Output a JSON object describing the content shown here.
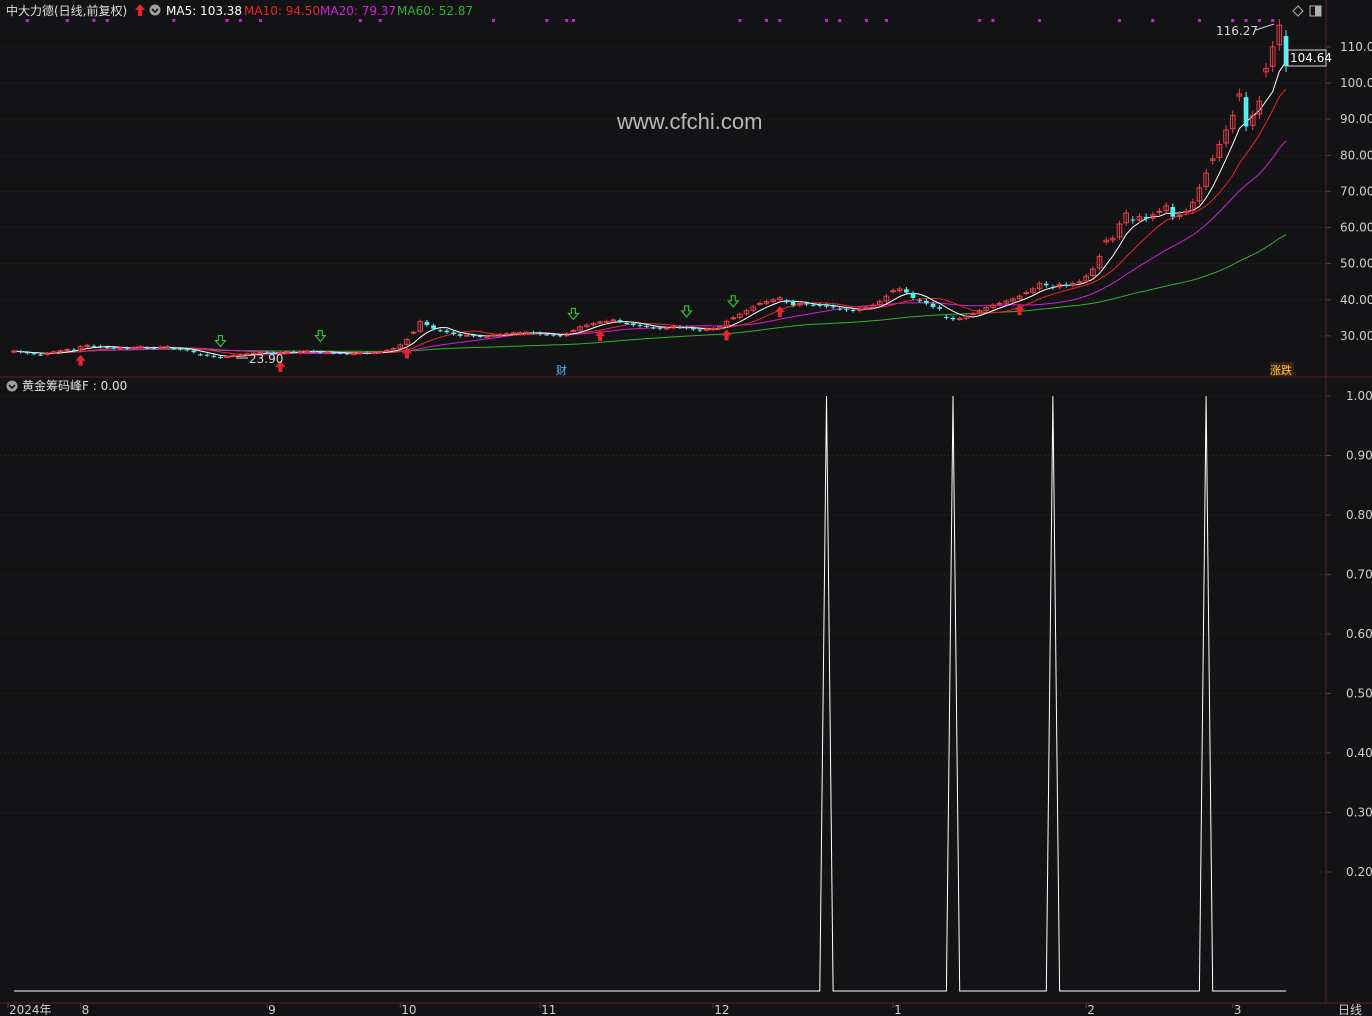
{
  "header": {
    "stock_title": "中大力德(日线,前复权)",
    "ma5": "MA5: 103.38",
    "ma10": "MA10: 94.50",
    "ma20": "MA20: 79.37",
    "ma60": "MA60: 52.87"
  },
  "colors": {
    "bg": "#131214",
    "grid": "#3a2a2a",
    "up": "#e8404a",
    "down": "#54f0f4",
    "ma5": "#ffffff",
    "ma10": "#e8252a",
    "ma20": "#d020d8",
    "ma60": "#30b030",
    "signal_dot": "#d020d8",
    "buy_arrow": "#e8252a",
    "sell_arrow": "#30c030",
    "indicator_line": "#ffffff"
  },
  "indicator": {
    "label": "黄金筹码峰F : 0.00"
  },
  "watermark": "www.cfchi.com",
  "annotations": {
    "high": "116.27",
    "low": "23.90",
    "last": "104.64",
    "cai": "财",
    "badge": "涨跌"
  },
  "x_axis": {
    "labels": [
      "2024年",
      "8",
      "9",
      "10",
      "11",
      "12",
      "1",
      "2",
      "3"
    ],
    "period": "日线"
  },
  "chart_data": [
    {
      "type": "candlestick",
      "title": "中大力德(日线,前复权)",
      "ylim": [
        20,
        118
      ],
      "yticks": [
        30,
        40,
        50,
        60,
        70,
        80,
        90,
        100,
        110
      ],
      "ytick_labels": [
        "30.00",
        "40.00",
        "50.00",
        "60.00",
        "70.00",
        "80.00",
        "90.00",
        "100.00",
        "110.0"
      ],
      "x_month_ticks": {
        "2024年": 0,
        "8": 10,
        "9": 38,
        "10": 58,
        "11": 79,
        "12": 105,
        "1": 132,
        "2": 161,
        "3": 183
      },
      "series": [
        {
          "name": "MA5",
          "last": 103.38
        },
        {
          "name": "MA10",
          "last": 94.5
        },
        {
          "name": "MA20",
          "last": 79.37
        },
        {
          "name": "MA60",
          "last": 52.87
        }
      ],
      "closes": [
        25.8,
        25.5,
        25.2,
        25.0,
        24.8,
        25.2,
        25.6,
        25.9,
        26.2,
        26.0,
        27.0,
        27.4,
        27.2,
        26.9,
        26.8,
        26.6,
        26.7,
        26.5,
        26.8,
        27.0,
        26.7,
        26.6,
        26.9,
        27.0,
        26.5,
        26.3,
        26.0,
        25.5,
        24.8,
        24.5,
        24.2,
        24.0,
        24.3,
        24.6,
        24.8,
        25.0,
        25.2,
        25.4,
        25.3,
        25.1,
        25.3,
        25.6,
        25.5,
        25.7,
        25.8,
        25.6,
        25.4,
        25.5,
        25.3,
        25.2,
        25.0,
        25.1,
        25.3,
        25.2,
        25.4,
        25.6,
        26.0,
        26.5,
        27.5,
        29.0,
        31.0,
        34.0,
        33.0,
        32.0,
        31.5,
        31.0,
        30.5,
        30.0,
        30.2,
        30.0,
        29.8,
        29.9,
        30.2,
        30.4,
        30.6,
        30.8,
        30.9,
        31.0,
        30.8,
        30.5,
        30.4,
        30.2,
        30.0,
        30.6,
        31.5,
        32.5,
        33.0,
        33.4,
        33.8,
        34.0,
        34.4,
        34.0,
        33.5,
        33.0,
        32.8,
        32.6,
        32.3,
        32.0,
        32.2,
        32.6,
        32.4,
        32.2,
        31.8,
        31.5,
        31.8,
        32.0,
        32.5,
        34.0,
        35.0,
        36.0,
        37.0,
        38.0,
        39.0,
        39.5,
        40.0,
        40.5,
        39.5,
        38.5,
        39.0,
        38.8,
        38.6,
        38.4,
        38.2,
        38.0,
        37.5,
        37.2,
        37.0,
        37.3,
        37.8,
        38.5,
        39.5,
        41.0,
        42.5,
        43.0,
        42.0,
        40.5,
        39.8,
        39.0,
        38.0,
        37.5,
        35.0,
        34.6,
        34.8,
        35.5,
        36.2,
        37.0,
        37.8,
        38.5,
        39.0,
        39.6,
        40.2,
        41.0,
        42.0,
        43.0,
        44.5,
        44.0,
        43.5,
        44.2,
        44.0,
        44.5,
        45.0,
        46.5,
        48.5,
        52.0,
        56.5,
        57.0,
        61.0,
        64.0,
        62.0,
        63.0,
        62.5,
        63.5,
        64.5,
        66.0,
        63.0,
        63.5,
        64.5,
        67.0,
        71.0,
        75.0,
        79.0,
        83.0,
        87.0,
        91.0,
        97.0,
        88.0,
        91.0,
        95.0,
        104.0,
        110.0,
        116.0,
        104.64
      ],
      "ma20_last": 79.37,
      "ma60_last": 52.87
    },
    {
      "type": "line",
      "name": "黄金筹码峰F",
      "ylim": [
        0.0,
        1.02
      ],
      "yticks": [
        0.2,
        0.3,
        0.4,
        0.5,
        0.6,
        0.7,
        0.8,
        0.9,
        1.0
      ],
      "ytick_labels": [
        "0.20",
        "0.30",
        "0.40",
        "0.50",
        "0.60",
        "0.70",
        "0.80",
        "0.90",
        "1.00"
      ],
      "spikes_at_index": [
        122,
        141,
        156,
        179
      ],
      "spike_value": 1.0,
      "base_value": 0.0,
      "last_value": 0.0
    }
  ]
}
